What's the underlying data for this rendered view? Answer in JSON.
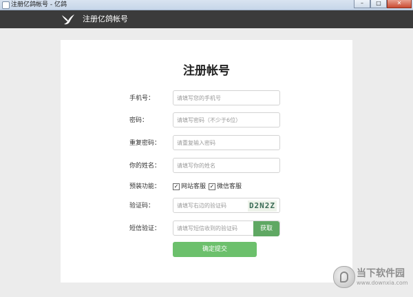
{
  "window": {
    "title": "注册亿鸽帐号 - 亿鸽",
    "minimize_symbol": "–",
    "maximize_symbol": "□",
    "close_symbol": "✕"
  },
  "header": {
    "title": "注册亿鸽帐号",
    "logo_icon": "dove-icon"
  },
  "form": {
    "title": "注册帐号",
    "phone": {
      "label": "手机号：",
      "placeholder": "请填写您的手机号"
    },
    "password": {
      "label": "密码：",
      "placeholder": "请填写密码（不少于6位）"
    },
    "confirm_password": {
      "label": "重复密码：",
      "placeholder": "请重复输入密码"
    },
    "name": {
      "label": "你的姓名：",
      "placeholder": "请填写你的姓名"
    },
    "features": {
      "label": "预装功能：",
      "options": [
        {
          "label": "网站客服",
          "checked": true
        },
        {
          "label": "微信客服",
          "checked": true
        }
      ]
    },
    "captcha": {
      "label": "验证码：",
      "placeholder": "请填写右边的验证码",
      "image_text": "D2N2Z"
    },
    "sms": {
      "label": "短信验证：",
      "placeholder": "请填写短信收到的验证码",
      "button": "获取"
    },
    "submit": "确定提交"
  },
  "watermark": {
    "name": "当下软件园",
    "url": "www.downxia.com"
  },
  "colors": {
    "header_bg": "#3b3b3b",
    "accent_green": "#5fa863",
    "submit_green": "#6cc06c"
  }
}
